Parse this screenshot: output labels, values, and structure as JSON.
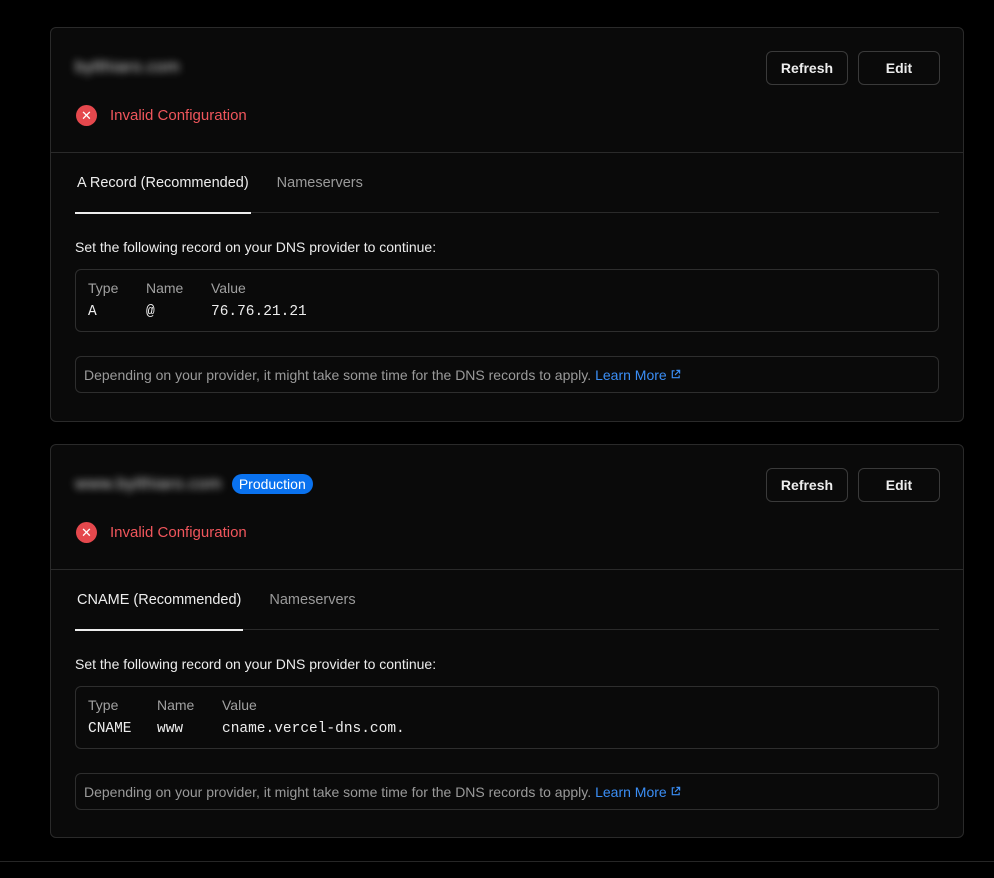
{
  "domains": [
    {
      "name": "bylthiaro.com",
      "badge": "",
      "refresh_label": "Refresh",
      "edit_label": "Edit",
      "status_icon": "x",
      "status_text": "Invalid Configuration",
      "tabs": [
        "A Record (Recommended)",
        "Nameservers"
      ],
      "active_tab": 0,
      "instruction": "Set the following record on your DNS provider to continue:",
      "record": {
        "headers": [
          "Type",
          "Name",
          "Value"
        ],
        "values": [
          "A",
          "@",
          "76.76.21.21"
        ]
      },
      "note_text": "Depending on your provider, it might take some time for the DNS records to apply.",
      "note_link": "Learn More"
    },
    {
      "name": "www.bylthiaro.com",
      "badge": "Production",
      "refresh_label": "Refresh",
      "edit_label": "Edit",
      "status_icon": "x",
      "status_text": "Invalid Configuration",
      "tabs": [
        "CNAME (Recommended)",
        "Nameservers"
      ],
      "active_tab": 0,
      "instruction": "Set the following record on your DNS provider to continue:",
      "record": {
        "headers": [
          "Type",
          "Name",
          "Value"
        ],
        "values": [
          "CNAME",
          "www",
          "cname.vercel-dns.com."
        ]
      },
      "note_text": "Depending on your provider, it might take some time for the DNS records to apply.",
      "note_link": "Learn More"
    }
  ],
  "colors": {
    "error": "#e5484d",
    "link": "#3b8ef5",
    "badge": "#0a72ef"
  }
}
